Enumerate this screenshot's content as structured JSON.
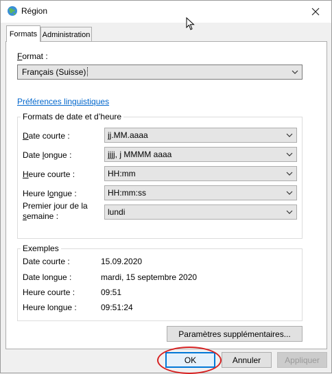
{
  "window": {
    "title": "Région"
  },
  "tabs": [
    {
      "label": "Formats",
      "active": true
    },
    {
      "label": "Administration",
      "active": false
    }
  ],
  "format": {
    "label": "Format :",
    "value": "Français (Suisse)"
  },
  "lang_link": "Préférences linguistiques",
  "date_time_group": {
    "title": "Formats de date et d’heure",
    "rows": [
      {
        "label": "Date courte :",
        "value": "jj.MM.aaaa"
      },
      {
        "label": "Date longue :",
        "value": "jjjj, j MMMM aaaa"
      },
      {
        "label": "Heure courte :",
        "value": "HH:mm"
      },
      {
        "label": "Heure longue :",
        "value": "HH:mm:ss"
      },
      {
        "label_line1": "Premier jour de la",
        "label_line2": "semaine :",
        "value": "lundi"
      }
    ]
  },
  "examples": {
    "title": "Exemples",
    "rows": [
      {
        "label": "Date courte :",
        "value": "15.09.2020"
      },
      {
        "label": "Date longue :",
        "value": "mardi, 15 septembre 2020"
      },
      {
        "label": "Heure courte :",
        "value": "09:51"
      },
      {
        "label": "Heure longue :",
        "value": "09:51:24"
      }
    ]
  },
  "buttons": {
    "more_settings": "Paramètres supplémentaires...",
    "ok": "OK",
    "cancel": "Annuler",
    "apply": "Appliquer"
  },
  "icons": {
    "window_icon": "globe-icon",
    "close": "close-icon",
    "dropdown": "chevron-down-icon",
    "cursor": "mouse-cursor-icon"
  },
  "colors": {
    "link": "#0066cc",
    "default_button_border": "#0078d7",
    "annotation": "#d62020"
  }
}
